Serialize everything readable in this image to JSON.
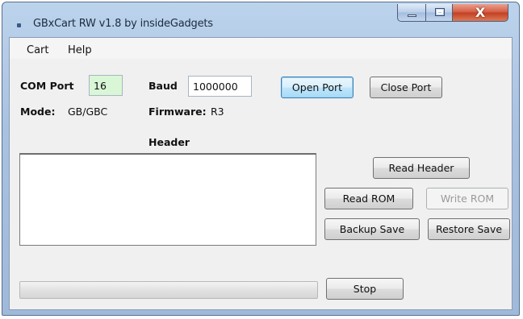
{
  "window": {
    "title": "GBxCart RW v1.8 by insideGadgets",
    "close_glyph": "X"
  },
  "menu": {
    "items": [
      "Cart",
      "Help"
    ]
  },
  "connection": {
    "com_port_label": "COM Port",
    "com_port_value": "16",
    "baud_label": "Baud",
    "baud_value": "1000000",
    "mode_label": "Mode:",
    "mode_value": "GB/GBC",
    "firmware_label": "Firmware:",
    "firmware_value": "R3"
  },
  "buttons": {
    "open_port": "Open Port",
    "close_port": "Close Port",
    "read_header": "Read Header",
    "read_rom": "Read ROM",
    "write_rom": "Write ROM",
    "backup_save": "Backup Save",
    "restore_save": "Restore Save",
    "stop": "Stop"
  },
  "header_panel": {
    "label": "Header",
    "content": ""
  },
  "progress": {
    "fraction": 0
  },
  "icons": {
    "app": "app-icon",
    "minimize": "minimize-icon",
    "maximize": "maximize-icon",
    "close": "close-icon"
  },
  "colors": {
    "com_port_field_bg": "#d9f7d6",
    "focused_button_border": "#3c7fb1",
    "close_button": "#c33e22"
  }
}
